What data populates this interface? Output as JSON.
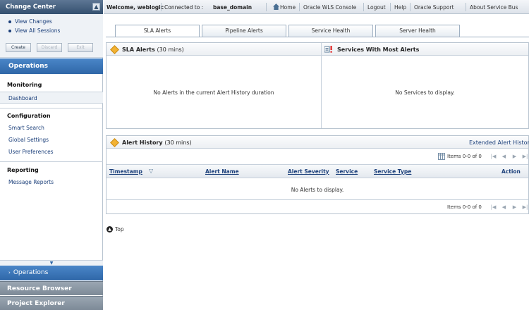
{
  "sidebar": {
    "change_center": {
      "title": "Change Center",
      "links": [
        "View Changes",
        "View All Sessions"
      ],
      "buttons": [
        "Create",
        "Discard",
        "Exit"
      ]
    },
    "operations_header": "Operations",
    "sections": [
      {
        "title": "Monitoring",
        "items": [
          "Dashboard"
        ]
      },
      {
        "title": "Configuration",
        "items": [
          "Smart Search",
          "Global Settings",
          "User Preferences"
        ]
      },
      {
        "title": "Reporting",
        "items": [
          "Message Reports"
        ]
      }
    ],
    "accordion": [
      "Operations",
      "Resource Browser",
      "Project Explorer"
    ]
  },
  "topbar": {
    "welcome": "Welcome, weblogic",
    "connected_label": "Connected to :",
    "domain": "base_domain",
    "links": [
      "Home",
      "Oracle WLS Console",
      "Logout",
      "Help",
      "Oracle Support",
      "About Service Bus"
    ]
  },
  "tabs": [
    "SLA Alerts",
    "Pipeline Alerts",
    "Service Health",
    "Server Health"
  ],
  "sla_panel": {
    "title": "SLA Alerts",
    "period": "(30 mins)",
    "empty": "No Alerts in the current Alert History duration"
  },
  "services_panel": {
    "title": "Services With Most Alerts",
    "empty": "No Services to display."
  },
  "history_panel": {
    "title": "Alert History",
    "period": "(30 mins)",
    "extended_link": "Extended Alert History",
    "pager_text": "Items 0-0 of 0",
    "columns": [
      "Timestamp",
      "Alert Name",
      "Alert Severity",
      "Service",
      "Service Type",
      "Action"
    ],
    "empty": "No Alerts to display."
  },
  "top_link": "Top",
  "colors": {
    "header_dark": "#34506f",
    "operations_blue": "#2f67a8",
    "link_blue": "#1b3f7a",
    "alert_diamond": "#f2b233"
  }
}
